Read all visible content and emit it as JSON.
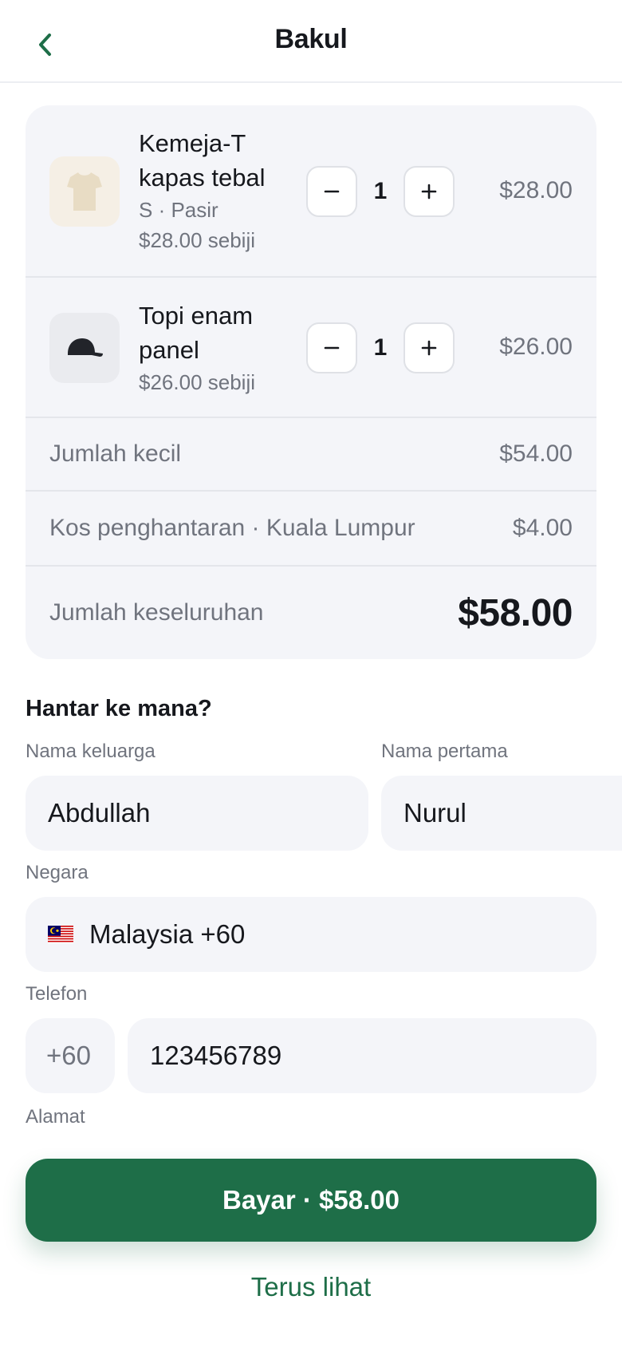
{
  "header": {
    "title": "Bakul",
    "back_icon": "chevron-left-icon"
  },
  "cart": {
    "items": [
      {
        "name": "Kemeja-T kapas tebal",
        "variant": "S · Pasir",
        "unit_price": "$28.00 sebiji",
        "quantity": "1",
        "line_total": "$28.00",
        "thumb_icon": "tshirt-icon",
        "thumb_color": "#e8dcc4"
      },
      {
        "name": "Topi enam panel",
        "unit_price": "$26.00 sebiji",
        "quantity": "1",
        "line_total": "$26.00",
        "thumb_icon": "cap-icon",
        "thumb_color": "#22242a"
      }
    ],
    "qty_minus_label": "−",
    "qty_plus_label": "+",
    "subtotal_label": "Jumlah kecil",
    "subtotal_value": "$54.00",
    "shipping_label": "Kos penghantaran · Kuala Lumpur",
    "shipping_value": "$4.00",
    "total_label": "Jumlah keseluruhan",
    "total_value": "$58.00"
  },
  "shipping_form": {
    "heading": "Hantar ke mana?",
    "last_name_label": "Nama keluarga",
    "last_name_value": "Abdullah",
    "first_name_label": "Nama pertama",
    "first_name_value": "Nurul",
    "country_label": "Negara",
    "country_value": "Malaysia +60",
    "country_flag_icon": "malaysia-flag-icon",
    "phone_label": "Telefon",
    "phone_prefix": "+60",
    "phone_value": "123456789",
    "address_label": "Alamat",
    "address_value": ""
  },
  "actions": {
    "pay_label": "Bayar · $58.00",
    "continue_label": "Terus lihat"
  },
  "colors": {
    "accent": "#1e6e48",
    "card_bg": "#f4f5f9",
    "muted_text": "#70747e"
  }
}
